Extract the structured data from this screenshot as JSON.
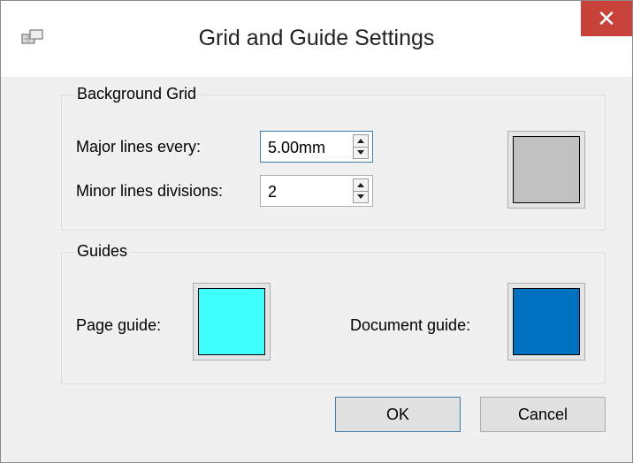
{
  "window": {
    "title": "Grid and Guide Settings",
    "close_glyph": "✕"
  },
  "background_grid": {
    "title": "Background Grid",
    "major_label": "Major lines every:",
    "major_value": "5.00mm",
    "minor_label": "Minor lines divisions:",
    "minor_value": "2",
    "grid_color": "#c0c0c0"
  },
  "guides": {
    "title": "Guides",
    "page_guide_label": "Page guide:",
    "page_guide_color": "#40ffff",
    "document_guide_label": "Document guide:",
    "document_guide_color": "#0070c0"
  },
  "buttons": {
    "ok": "OK",
    "cancel": "Cancel"
  },
  "icons": {
    "app": "grid-settings-icon",
    "close": "close-icon",
    "spin_up": "spin-up-icon",
    "spin_down": "spin-down-icon"
  }
}
